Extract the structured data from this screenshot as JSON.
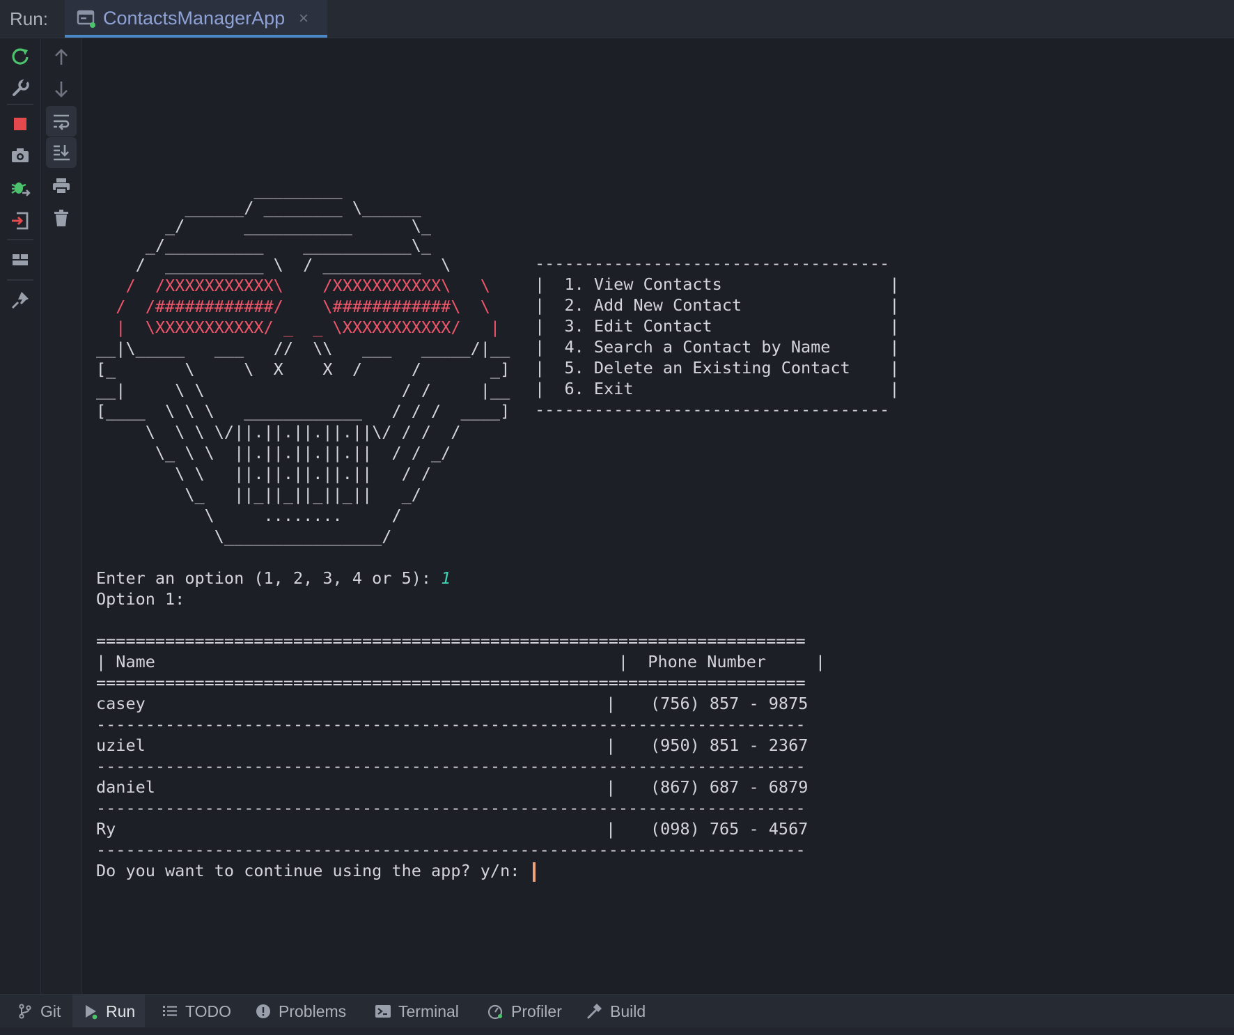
{
  "topbar": {
    "run_label": "Run:",
    "tab_title": "ContactsManagerApp",
    "tab_close": "×"
  },
  "console": {
    "art": [
      "                _________",
      "         ______/ ________ \\______",
      "       _/      ___________      \\_",
      "     _/__________    ___________\\_",
      "    /  __________ \\  / __________  \\",
      "   /  /XXXXXXXXXXX\\    /XXXXXXXXXXX\\   \\",
      "  /  /############/    \\############\\  \\",
      "  |  \\XXXXXXXXXXX/ _  _ \\XXXXXXXXXXX/   |",
      "__|\\_____   ___   //  \\\\   ___   _____/|__",
      "[_       \\     \\  X    X  /     /       _]",
      "__|     \\ \\                    / /     |__",
      "[____  \\ \\ \\   ____________   / / /  ____]",
      "     \\  \\ \\ \\/||.||.||.||.||\\/ / /  /",
      "      \\_ \\ \\  ||.||.||.||.||  / / _/",
      "        \\ \\   ||.||.||.||.||   / /",
      "         \\_   ||_||_||_||_||   _/",
      "           \\     ........     /",
      "            \\________________/"
    ],
    "menu": [
      "------------------------------------",
      "|  1. View Contacts                 |",
      "|  2. Add New Contact               |",
      "|  3. Edit Contact                  |",
      "|  4. Search a Contact by Name      |",
      "|  5. Delete an Existing Contact    |",
      "|  6. Exit                          |",
      "------------------------------------"
    ],
    "prompt_option": "Enter an option (1, 2, 3, 4 or 5): ",
    "prompt_option_value": "1",
    "option_header": "Option 1:",
    "table_rule": "========================================================================",
    "table_header": "| Name                                               |  Phone Number     |",
    "row_rule": "------------------------------------------------------------------------",
    "contacts": [
      {
        "name": "casey",
        "phone": "(756) 857 - 9875"
      },
      {
        "name": "uziel",
        "phone": "(950) 851 - 2367"
      },
      {
        "name": "daniel",
        "phone": "(867) 687 - 6879"
      },
      {
        "name": "Ry",
        "phone": "(098) 765 - 4567"
      }
    ],
    "continue_prompt": "Do you want to continue using the app? y/n: "
  },
  "bottombar": {
    "items": [
      {
        "label": "Git",
        "icon": "git-branch-icon"
      },
      {
        "label": "Run",
        "icon": "run-icon"
      },
      {
        "label": "TODO",
        "icon": "todo-list-icon"
      },
      {
        "label": "Problems",
        "icon": "problems-icon"
      },
      {
        "label": "Terminal",
        "icon": "terminal-icon"
      },
      {
        "label": "Profiler",
        "icon": "profiler-icon"
      },
      {
        "label": "Build",
        "icon": "hammer-icon"
      }
    ]
  },
  "colors": {
    "accent": "#4a88c7",
    "art_red": "#f0566a",
    "input_echo": "#3fd2b3",
    "run_green": "#4bc26b",
    "stop_red": "#e5484d"
  }
}
